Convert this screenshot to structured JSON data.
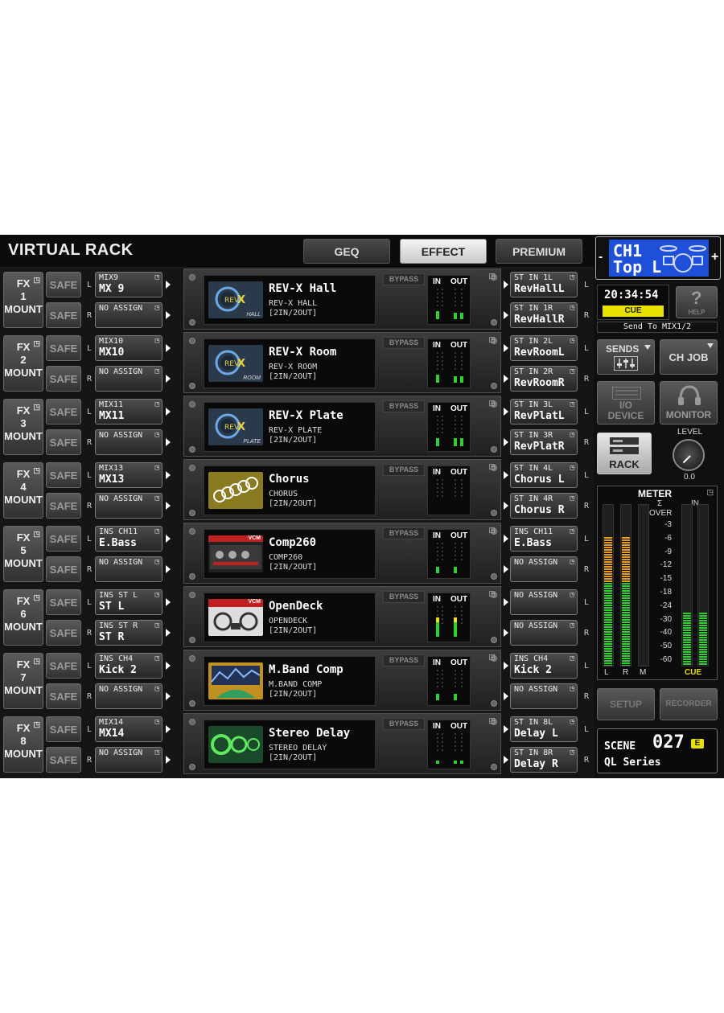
{
  "header": {
    "title": "VIRTUAL RACK",
    "tabs": [
      {
        "label": "GEQ",
        "active": false
      },
      {
        "label": "EFFECT",
        "active": true
      },
      {
        "label": "PREMIUM",
        "active": false
      }
    ]
  },
  "rack_labels": {
    "fx": "FX",
    "mount": "MOUNT",
    "safe": "SAFE",
    "bypass": "BYPASS",
    "in": "IN",
    "out": "OUT",
    "l": "L",
    "r": "R"
  },
  "racks": [
    {
      "num": "1",
      "in_l": {
        "top": "MIX9",
        "bottom": "MX 9"
      },
      "in_r": {
        "top": "NO ASSIGN",
        "bottom": ""
      },
      "effect": {
        "name": "REV-X Hall",
        "type": "REV-X HALL",
        "io": "[2IN/2OUT]",
        "thumb": "revx",
        "thumb_label": "HALL"
      },
      "out_l": {
        "top": "ST IN 1L",
        "bottom": "RevHallL"
      },
      "out_r": {
        "top": "ST IN 1R",
        "bottom": "RevHallR"
      },
      "meter_in": [
        0.25,
        0.0
      ],
      "meter_out": [
        0.2,
        0.2
      ]
    },
    {
      "num": "2",
      "in_l": {
        "top": "MIX10",
        "bottom": "MX10"
      },
      "in_r": {
        "top": "NO ASSIGN",
        "bottom": ""
      },
      "effect": {
        "name": "REV-X Room",
        "type": "REV-X ROOM",
        "io": "[2IN/2OUT]",
        "thumb": "revx",
        "thumb_label": "ROOM"
      },
      "out_l": {
        "top": "ST IN 2L",
        "bottom": "RevRoomL"
      },
      "out_r": {
        "top": "ST IN 2R",
        "bottom": "RevRoomR"
      },
      "meter_in": [
        0.25,
        0.0
      ],
      "meter_out": [
        0.2,
        0.2
      ]
    },
    {
      "num": "3",
      "in_l": {
        "top": "MIX11",
        "bottom": "MX11"
      },
      "in_r": {
        "top": "NO ASSIGN",
        "bottom": ""
      },
      "effect": {
        "name": "REV-X Plate",
        "type": "REV-X PLATE",
        "io": "[2IN/2OUT]",
        "thumb": "revx",
        "thumb_label": "PLATE"
      },
      "out_l": {
        "top": "ST IN 3L",
        "bottom": "RevPlatL"
      },
      "out_r": {
        "top": "ST IN 3R",
        "bottom": "RevPlatR"
      },
      "meter_in": [
        0.25,
        0.0
      ],
      "meter_out": [
        0.25,
        0.25
      ]
    },
    {
      "num": "4",
      "in_l": {
        "top": "MIX13",
        "bottom": "MX13"
      },
      "in_r": {
        "top": "NO ASSIGN",
        "bottom": ""
      },
      "effect": {
        "name": "Chorus",
        "type": "CHORUS",
        "io": "[2IN/2OUT]",
        "thumb": "chorus",
        "thumb_label": ""
      },
      "out_l": {
        "top": "ST IN 4L",
        "bottom": "Chorus L"
      },
      "out_r": {
        "top": "ST IN 4R",
        "bottom": "Chorus R"
      },
      "meter_in": [
        0.0,
        0.0
      ],
      "meter_out": [
        0.0,
        0.0
      ]
    },
    {
      "num": "5",
      "in_l": {
        "top": "INS CH11",
        "bottom": "E.Bass"
      },
      "in_r": {
        "top": "NO ASSIGN",
        "bottom": ""
      },
      "effect": {
        "name": "Comp260",
        "type": "COMP260",
        "io": "[2IN/2OUT]",
        "thumb": "vcm",
        "thumb_label": "VCM"
      },
      "out_l": {
        "top": "INS CH11",
        "bottom": "E.Bass"
      },
      "out_r": {
        "top": "NO ASSIGN",
        "bottom": ""
      },
      "meter_in": [
        0.2,
        0.0
      ],
      "meter_out": [
        0.2,
        0.0
      ]
    },
    {
      "num": "6",
      "in_l": {
        "top": "INS ST L",
        "bottom": "ST L"
      },
      "in_r": {
        "top": "INS ST R",
        "bottom": "ST R"
      },
      "effect": {
        "name": "OpenDeck",
        "type": "OPENDECK",
        "io": "[2IN/2OUT]",
        "thumb": "opendeck",
        "thumb_label": "VCM"
      },
      "out_l": {
        "top": "NO ASSIGN",
        "bottom": ""
      },
      "out_r": {
        "top": "NO ASSIGN",
        "bottom": ""
      },
      "meter_in": [
        0.6,
        0.0
      ],
      "meter_out": [
        0.6,
        0.0
      ]
    },
    {
      "num": "7",
      "in_l": {
        "top": "INS CH4",
        "bottom": "Kick 2"
      },
      "in_r": {
        "top": "NO ASSIGN",
        "bottom": ""
      },
      "effect": {
        "name": "M.Band Comp",
        "type": "M.BAND COMP",
        "io": "[2IN/2OUT]",
        "thumb": "mband",
        "thumb_label": ""
      },
      "out_l": {
        "top": "INS CH4",
        "bottom": "Kick 2"
      },
      "out_r": {
        "top": "NO ASSIGN",
        "bottom": ""
      },
      "meter_in": [
        0.2,
        0.0
      ],
      "meter_out": [
        0.2,
        0.0
      ]
    },
    {
      "num": "8",
      "in_l": {
        "top": "MIX14",
        "bottom": "MX14"
      },
      "in_r": {
        "top": "NO ASSIGN",
        "bottom": ""
      },
      "effect": {
        "name": "Stereo Delay",
        "type": "STEREO DELAY",
        "io": "[2IN/2OUT]",
        "thumb": "delay",
        "thumb_label": ""
      },
      "out_l": {
        "top": "ST IN 8L",
        "bottom": "Delay L"
      },
      "out_r": {
        "top": "ST IN 8R",
        "bottom": "Delay R"
      },
      "meter_in": [
        0.1,
        0.0
      ],
      "meter_out": [
        0.1,
        0.1
      ]
    }
  ],
  "sidebar": {
    "channel": {
      "id": "CH1",
      "name": "Top L",
      "minus": "-",
      "plus": "+"
    },
    "clock": "20:34:54",
    "cue": "CUE",
    "help": "HELP",
    "send_to": "Send To MIX1/2",
    "sends": "SENDS",
    "ch_job": "CH JOB",
    "io_device_line1": "I/O",
    "io_device_line2": "DEVICE",
    "monitor": "MONITOR",
    "rack": "RACK",
    "level_label": "LEVEL",
    "level_value": "0.0",
    "meter": {
      "title": "METER",
      "sigma": "Σ",
      "over": "OVER",
      "scale": [
        "-3",
        "-6",
        "-9",
        "-12",
        "-15",
        "-18",
        "-24",
        "-30",
        "-40",
        "-50",
        "-60"
      ],
      "l_label": "L",
      "r_label": "R",
      "m_label": "M",
      "in_label": "IN",
      "cue_label": "CUE",
      "levels": {
        "L": 0.8,
        "R": 0.8,
        "M": 0.0,
        "IN_L": 0.33,
        "IN_R": 0.33
      }
    },
    "setup": "SETUP",
    "recorder": "RECORDER",
    "scene_label": "SCENE",
    "scene_number": "027",
    "scene_badge": "E",
    "scene_name": "QL Series"
  },
  "colors": {
    "accent_blue": "#1e4fd8",
    "cue_yellow": "#e8e000",
    "meter_green": "#30d030",
    "meter_orange": "#e8a020",
    "meter_yellow": "#e8e030"
  }
}
